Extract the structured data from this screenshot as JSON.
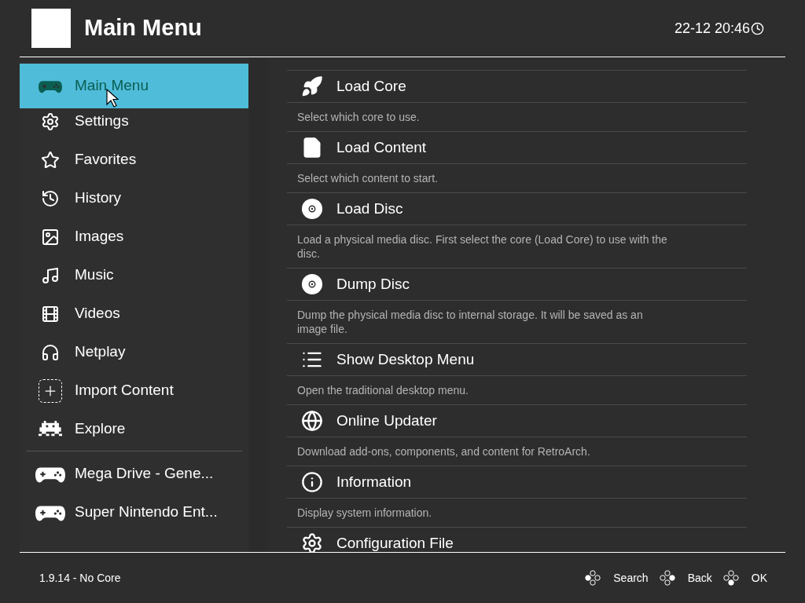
{
  "header": {
    "title": "Main Menu",
    "clock": "22-12 20:46"
  },
  "sidebar": {
    "items": [
      {
        "label": "Main Menu",
        "selected": true
      },
      {
        "label": "Settings",
        "selected": false
      },
      {
        "label": "Favorites",
        "selected": false
      },
      {
        "label": "History",
        "selected": false
      },
      {
        "label": "Images",
        "selected": false
      },
      {
        "label": "Music",
        "selected": false
      },
      {
        "label": "Videos",
        "selected": false
      },
      {
        "label": "Netplay",
        "selected": false
      },
      {
        "label": "Import Content",
        "selected": false
      },
      {
        "label": "Explore",
        "selected": false
      }
    ],
    "playlists": [
      {
        "label": "Mega Drive - Gene...",
        "selected": false
      },
      {
        "label": "Super Nintendo Ent...",
        "selected": false
      }
    ]
  },
  "entries": [
    {
      "title": "Load Core",
      "description": "Select which core to use."
    },
    {
      "title": "Load Content",
      "description": "Select which content to start."
    },
    {
      "title": "Load Disc",
      "description": "Load a physical media disc. First select the core (Load Core) to use with the disc."
    },
    {
      "title": "Dump Disc",
      "description": "Dump the physical media disc to internal storage. It will be saved as an image file."
    },
    {
      "title": "Show Desktop Menu",
      "description": "Open the traditional desktop menu."
    },
    {
      "title": "Online Updater",
      "description": "Download add-ons, components, and content for RetroArch."
    },
    {
      "title": "Information",
      "description": "Display system information."
    },
    {
      "title": "Configuration File"
    }
  ],
  "footer": {
    "version": "1.9.14 - No Core",
    "buttons": [
      {
        "label": "Search",
        "kind": "west"
      },
      {
        "label": "Back",
        "kind": "east"
      },
      {
        "label": "OK",
        "kind": "south"
      }
    ]
  }
}
